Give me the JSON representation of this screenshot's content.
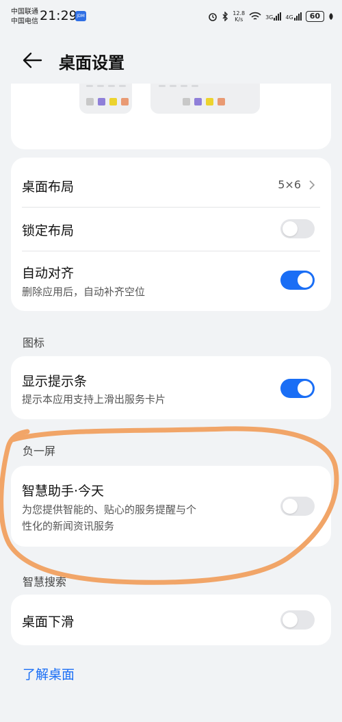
{
  "status_bar": {
    "carrier_1": "中国联通",
    "carrier_2": "中国电信",
    "time": "21:29",
    "app_badge": "JDM",
    "net_speed_value": "12.8",
    "net_speed_unit": "K/s",
    "net_type_1": "3G",
    "net_type_2": "4G",
    "battery": "60"
  },
  "header": {
    "title": "桌面设置"
  },
  "layout_card": {
    "desktop_layout": {
      "label": "桌面布局",
      "value": "5×6"
    },
    "lock_layout": {
      "label": "锁定布局",
      "enabled": false
    },
    "auto_align": {
      "label": "自动对齐",
      "description": "删除应用后，自动补齐空位",
      "enabled": true
    }
  },
  "icons_section": {
    "label": "图标",
    "show_hint_bar": {
      "label": "显示提示条",
      "description": "提示本应用支持上滑出服务卡片",
      "enabled": true
    }
  },
  "minus_one_screen": {
    "label": "负一屏",
    "assistant_today": {
      "label": "智慧助手·今天",
      "description_line1": "为您提供智能的、贴心的服务提醒与个",
      "description_line2": "性化的新闻资讯服务",
      "enabled": false
    }
  },
  "smart_search": {
    "label": "智慧搜索",
    "desktop_swipe_down": {
      "label": "桌面下滑",
      "enabled": false
    }
  },
  "learn_link": "了解桌面",
  "colors": {
    "accent": "#1a6ef5",
    "annotation": "#f0a060",
    "preview_dots": [
      "#c8c8c8",
      "#8f7fd9",
      "#ecd32e",
      "#e99a73"
    ]
  }
}
